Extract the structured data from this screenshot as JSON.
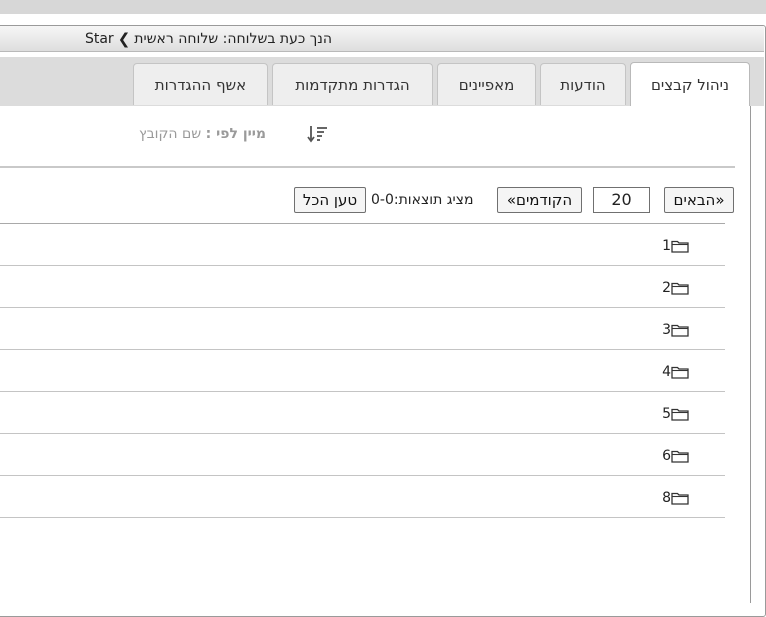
{
  "branch_bar": {
    "prefix": "הנך כעת בשלוחה: שלוחה ראשית",
    "separator_icon": "chevron-left-icon",
    "root": "Star"
  },
  "tabs": [
    {
      "label": "ניהול קבצים",
      "active": true
    },
    {
      "label": "הודעות",
      "active": false
    },
    {
      "label": "מאפיינים",
      "active": false
    },
    {
      "label": "הגדרות מתקדמות",
      "active": false
    },
    {
      "label": "אשף ההגדרות",
      "active": false
    }
  ],
  "sort": {
    "key_label": "מיין לפי :",
    "value": "שם הקובץ",
    "icon": "sort-descending-icon"
  },
  "pager": {
    "next_label": "«הבאים",
    "page_size": "20",
    "prev_label": "הקודמים»",
    "results_label": "מציג תוצאות:0-0",
    "load_all_label": "טען הכל"
  },
  "folders": [
    {
      "name": "1"
    },
    {
      "name": "2"
    },
    {
      "name": "3"
    },
    {
      "name": "4"
    },
    {
      "name": "5"
    },
    {
      "name": "6"
    },
    {
      "name": "8"
    }
  ],
  "colors": {
    "tab_inactive_bg": "#eeeeee",
    "tab_active_bg": "#ffffff",
    "tabbar_bg": "#dcdcdc",
    "muted_text": "#9a9a9a"
  }
}
